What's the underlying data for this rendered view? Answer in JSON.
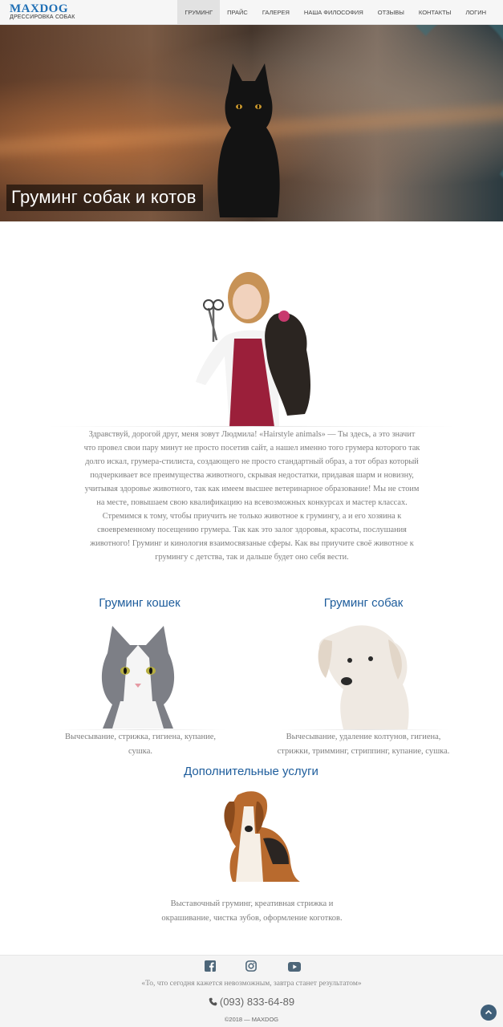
{
  "header": {
    "logo_name": "MAXDOG",
    "logo_sub": "ДРЕССИРОВКА СОБАК",
    "menu": [
      {
        "label": "ГРУМИНГ",
        "active": true
      },
      {
        "label": "ПРАЙС"
      },
      {
        "label": "ГАЛЕРЕЯ"
      },
      {
        "label": "НАША ФИЛОСОФИЯ"
      },
      {
        "label": "ОТЗЫВЫ"
      },
      {
        "label": "КОНТАКТЫ"
      },
      {
        "label": "ЛОГИН"
      }
    ]
  },
  "hero": {
    "title": "Груминг собак и котов"
  },
  "intro": {
    "text": "Здравствуй, дорогой друг, меня зовут Людмила! «Hairstyle animals» — Ты здесь, а это значит что провел свои пару минут не просто посетив сайт, а нашел именно того грумера которого так долго искал, грумера-стилиста, создающего не просто стандартный образ, а тот образ который подчеркивает все преимущества животного, скрывая недостатки, придавая шарм и новизну, учитывая здоровье животного, так как имеем высшее ветеринарное образование! Мы не стоим на месте, повышаем свою квалификацию на всевозможных конкурсах и мастер классах. Стремимся к тому, чтобы приучить не только животное к грумингу, а и его хозяина к своевременному посещению грумера. Так как это залог здоровья, красоты, послушания животного! Груминг и кинология взаимосвязаные сферы. Как вы приучите своё животное к грумингу с детства, так и дальше будет оно себя вести."
  },
  "services": {
    "cats": {
      "title": "Груминг кошек",
      "desc": "Вычесывание, стрижка, гигиена, купание, сушка."
    },
    "dogs": {
      "title": "Груминг собак",
      "desc": "Вычесывание, удаление колтунов, гигиена, стрижки, тримминг, стриппинг, купание, сушка."
    },
    "extra": {
      "title": "Дополнительные услуги",
      "desc": "Выставочный груминг, креативная стрижка и окрашивание, чистка зубов, оформление коготков."
    }
  },
  "footer": {
    "social_icons": [
      "facebook-icon",
      "instagram-icon",
      "youtube-icon"
    ],
    "quote": "«То, что сегодня кажется невозможным, завтра станет результатом»",
    "phone": "(093) 833-64-89",
    "copyright": "©2018 — MAXDOG",
    "to_top_icon": "chevron-up-icon"
  },
  "colors": {
    "accent": "#1e5d9c",
    "logo": "#1f6fb5",
    "to_top": "#3f5f79"
  }
}
